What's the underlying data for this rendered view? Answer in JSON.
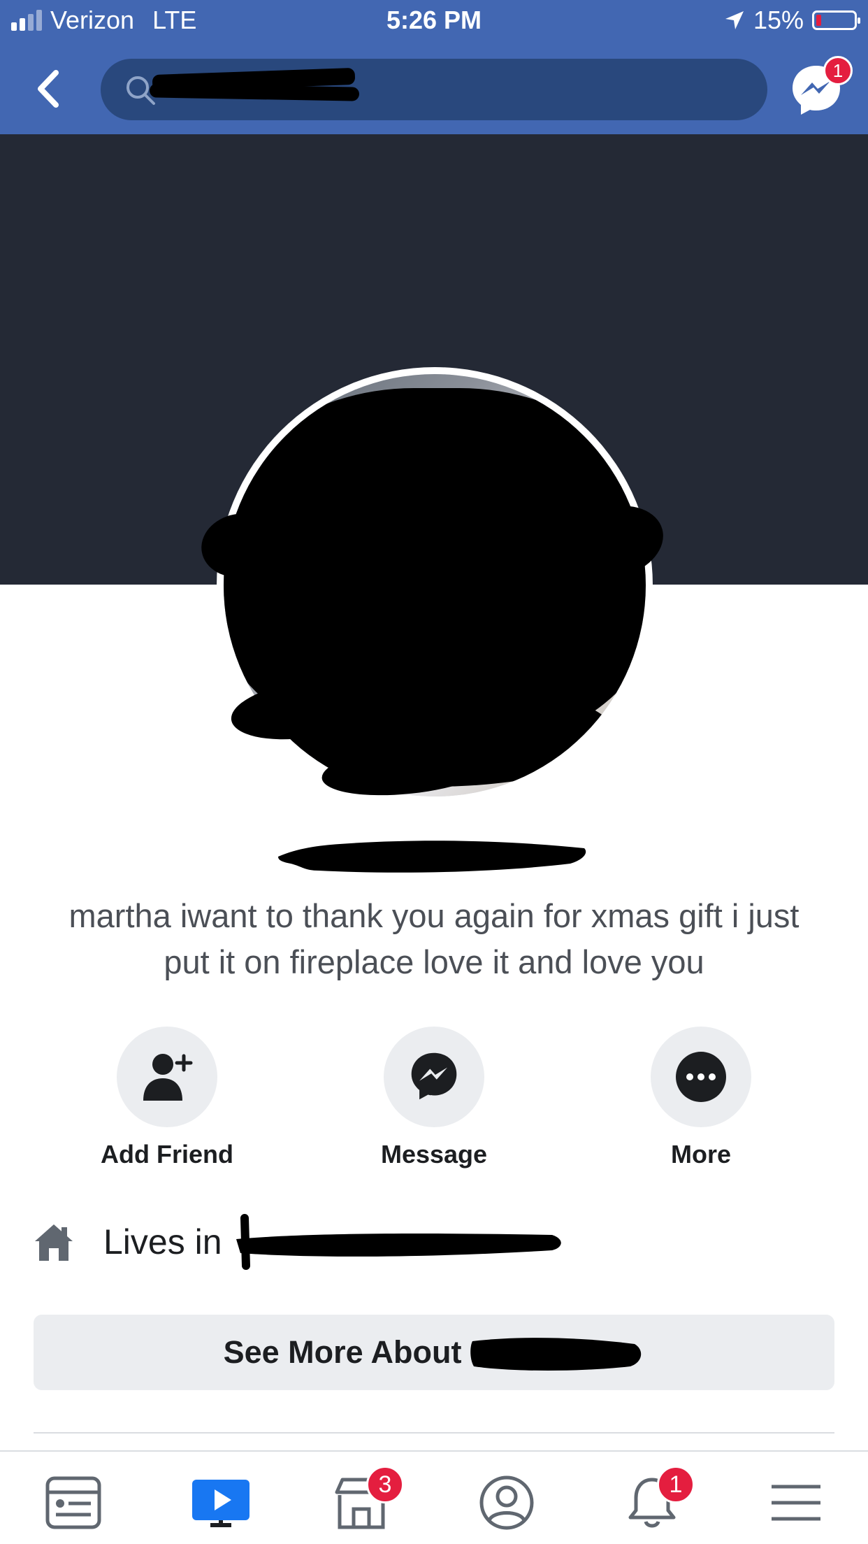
{
  "status_bar": {
    "carrier": "Verizon",
    "network": "LTE",
    "time": "5:26 PM",
    "battery": "15%",
    "icons": [
      "signal-icon",
      "location-arrow-icon",
      "battery-icon"
    ]
  },
  "nav": {
    "back_icon": "chevron-left-icon",
    "search_icon": "search-icon",
    "messenger_icon": "messenger-icon",
    "messenger_badge": "1"
  },
  "profile": {
    "bio": "martha iwant to thank you again for xmas gift i just put it on fireplace love it and love you"
  },
  "actions": [
    {
      "label": "Add Friend",
      "icon": "add-friend-icon"
    },
    {
      "label": "Message",
      "icon": "messenger-icon"
    },
    {
      "label": "More",
      "icon": "more-icon"
    }
  ],
  "about": {
    "lives_in_label": "Lives in",
    "lives_icon": "home-icon"
  },
  "see_more": {
    "label": "See More About"
  },
  "tabbar": {
    "tabs": [
      {
        "icon": "news-feed-icon",
        "badge": ""
      },
      {
        "icon": "watch-icon",
        "badge": ""
      },
      {
        "icon": "marketplace-icon",
        "badge": "3"
      },
      {
        "icon": "profile-icon",
        "badge": ""
      },
      {
        "icon": "notifications-icon",
        "badge": "1"
      },
      {
        "icon": "menu-icon",
        "badge": ""
      }
    ]
  },
  "colors": {
    "brand_blue": "#4267b2",
    "search_bg": "#29487d",
    "cover_bg": "#242935",
    "badge_red": "#e41e3f",
    "button_gray": "#ebedf0",
    "active_tab": "#1877f2"
  }
}
